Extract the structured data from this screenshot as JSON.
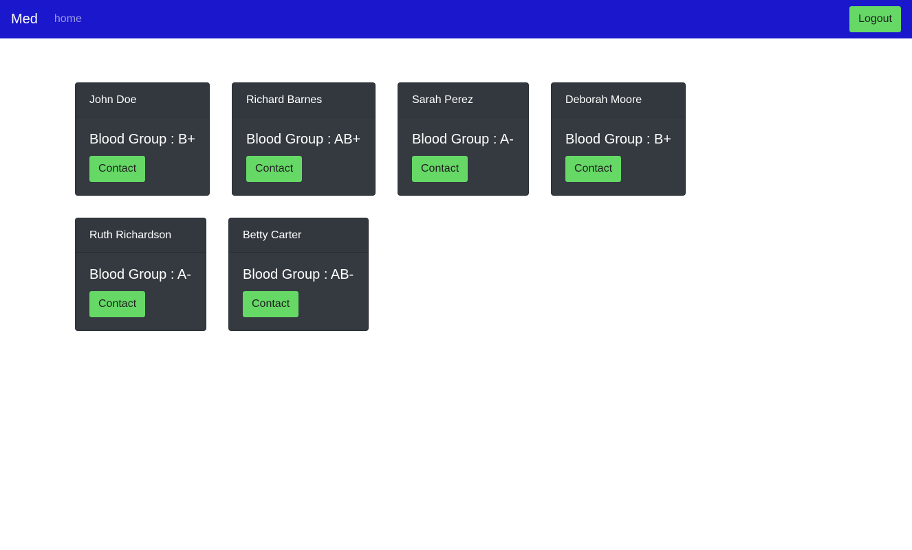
{
  "navbar": {
    "brand": "Med",
    "home_link": "home",
    "logout_label": "Logout",
    "bg_color": "#1a17cc",
    "button_color": "#66d866"
  },
  "donors": [
    {
      "name": "John Doe",
      "blood_label": "Blood Group : B+",
      "contact_label": "Contact"
    },
    {
      "name": "Richard Barnes",
      "blood_label": "Blood Group : AB+",
      "contact_label": "Contact"
    },
    {
      "name": "Sarah Perez",
      "blood_label": "Blood Group : A-",
      "contact_label": "Contact"
    },
    {
      "name": "Deborah Moore",
      "blood_label": "Blood Group : B+",
      "contact_label": "Contact"
    },
    {
      "name": "Ruth Richardson",
      "blood_label": "Blood Group : A-",
      "contact_label": "Contact"
    },
    {
      "name": "Betty Carter",
      "blood_label": "Blood Group : AB-",
      "contact_label": "Contact"
    }
  ]
}
